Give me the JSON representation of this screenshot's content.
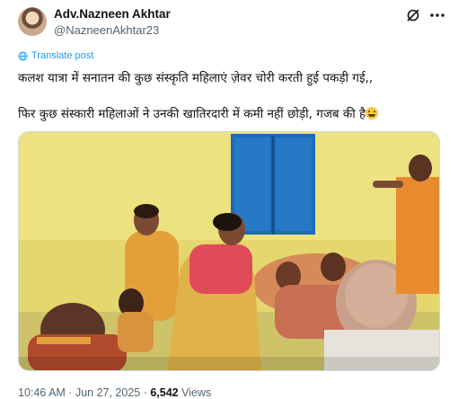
{
  "author": {
    "name": "Adv.Nazneen Akhtar",
    "handle": "@NazneenAkhtar23"
  },
  "translate_label": "Translate post",
  "post_lines": [
    "कलश यात्रा में सनातन की कुछ संस्कृति महिलाएं ज़ेवर चोरी करती हुई पकड़ी गई,,",
    "फिर कुछ संस्कारी महिलाओं ने उनकी खातिरदारी में कमी नहीं छोड़ी, गजब की है"
  ],
  "meta": {
    "time": "10:46 AM",
    "sep": " · ",
    "date": "Jun 27, 2025",
    "views_count": "6,542",
    "views_label": " Views"
  },
  "icons": [
    "grok-icon",
    "more-icon",
    "globe-icon",
    "smile-emoji"
  ],
  "colors": {
    "link": "#1d9bf0",
    "secondary": "#536471",
    "wall": "#e7dc74",
    "window": "#1d6fb5"
  }
}
